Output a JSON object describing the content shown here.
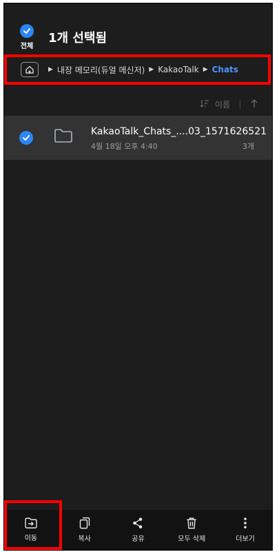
{
  "header": {
    "select_all_label": "전체",
    "title": "1개 선택됨"
  },
  "breadcrumb": {
    "items": [
      "내장 메모리(듀얼 메신저)",
      "KakaoTalk"
    ],
    "current": "Chats"
  },
  "sort": {
    "label": "이름"
  },
  "files": [
    {
      "name": "KakaoTalk_Chats_....03_1571626521",
      "date": "4월 18일 오후 4:40",
      "count": "3개",
      "selected": true
    }
  ],
  "bottom_bar": {
    "move": "이동",
    "copy": "복사",
    "share": "공유",
    "delete_all": "모두 삭제",
    "more": "더보기"
  },
  "colors": {
    "accent": "#2b86f7",
    "current_crumb": "#4b93ff",
    "highlight": "#ff0000"
  }
}
